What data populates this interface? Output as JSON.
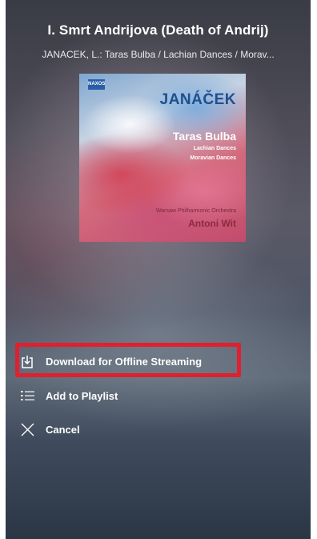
{
  "now_playing": {
    "track_title": "I. Smrt Andrijova (Death of Andrij)",
    "album_line": "JANACEK, L.: Taras Bulba / Lachian Dances / Morav..."
  },
  "album_art": {
    "label": "NAXOS",
    "composer": "JANÁČEK",
    "work_main": "Taras Bulba",
    "work_sub_1": "Lachian Dances",
    "work_sub_2": "Moravian Dances",
    "orchestra": "Warsaw Philharmonic Orchestra",
    "conductor": "Antoni Wit"
  },
  "menu": {
    "download_label": "Download for Offline Streaming",
    "playlist_label": "Add to Playlist",
    "cancel_label": "Cancel"
  },
  "colors": {
    "highlight": "#e0202e"
  }
}
